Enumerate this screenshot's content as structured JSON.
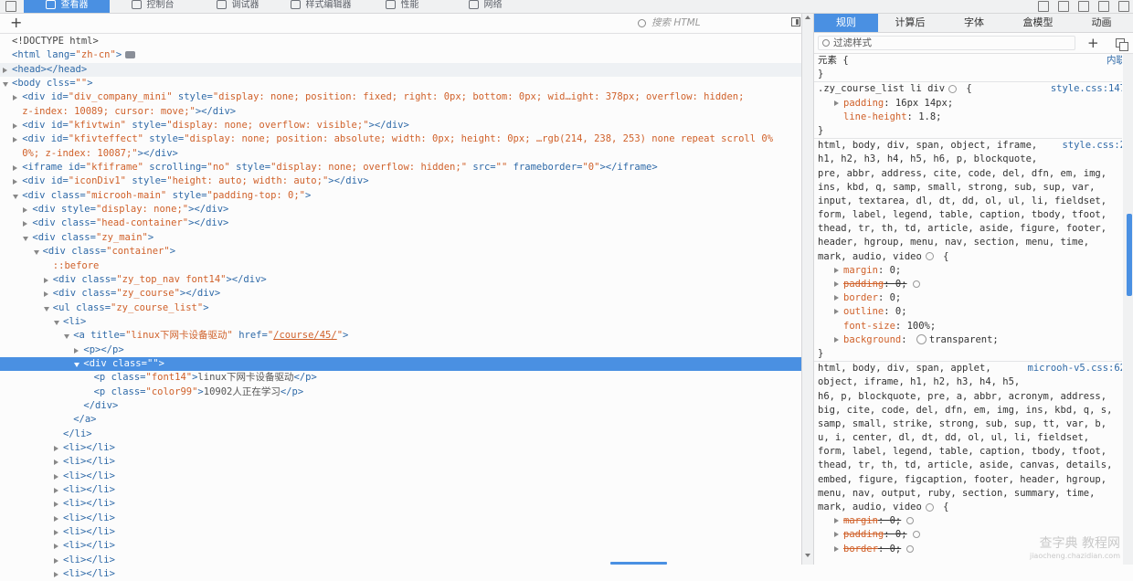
{
  "top_tabs": [
    "查看器",
    "控制台",
    "调试器",
    "样式编辑器",
    "性能",
    "网络"
  ],
  "markup": {
    "search_placeholder": "搜索 HTML",
    "add_label": "+",
    "lines": [
      [
        {
          "c": "p",
          "t": "<!DOCTYPE html>"
        }
      ],
      [
        {
          "c": "t",
          "t": "<html"
        },
        {
          "c": "a",
          "t": " lang="
        },
        {
          "c": "v",
          "t": "\"zh-cn\""
        },
        {
          "c": "t",
          "t": ">"
        }
      ],
      [
        {
          "c": "t",
          "t": "<head></head>"
        }
      ],
      [
        {
          "c": "t",
          "t": "<body"
        },
        {
          "c": "a",
          "t": " clss="
        },
        {
          "c": "v",
          "t": "\"\""
        },
        {
          "c": "t",
          "t": ">"
        }
      ],
      [
        {
          "c": "t",
          "t": "<div"
        },
        {
          "c": "a",
          "t": " id="
        },
        {
          "c": "v",
          "t": "\"div_company_mini\""
        },
        {
          "c": "a",
          "t": " style="
        },
        {
          "c": "v",
          "t": "\"display: none; position: fixed; right: 0px; bottom: 0px; wid…ight: 378px; overflow: hidden;"
        }
      ],
      [
        {
          "c": "v",
          "t": "z-index: 10089; cursor: move;\""
        },
        {
          "c": "t",
          "t": "></div>"
        }
      ],
      [
        {
          "c": "t",
          "t": "<div"
        },
        {
          "c": "a",
          "t": " id="
        },
        {
          "c": "v",
          "t": "\"kfivtwin\""
        },
        {
          "c": "a",
          "t": " style="
        },
        {
          "c": "v",
          "t": "\"display: none; overflow: visible;\""
        },
        {
          "c": "t",
          "t": "></div>"
        }
      ],
      [
        {
          "c": "t",
          "t": "<div"
        },
        {
          "c": "a",
          "t": " id="
        },
        {
          "c": "v",
          "t": "\"kfivteffect\""
        },
        {
          "c": "a",
          "t": " style="
        },
        {
          "c": "v",
          "t": "\"display: none; position: absolute; width: 0px; height: 0px; …rgb(214, 238, 253) none repeat scroll 0%"
        }
      ],
      [
        {
          "c": "v",
          "t": "0%; z-index: 10087;\""
        },
        {
          "c": "t",
          "t": "></div>"
        }
      ],
      [
        {
          "c": "t",
          "t": "<iframe"
        },
        {
          "c": "a",
          "t": " id="
        },
        {
          "c": "v",
          "t": "\"kfiframe\""
        },
        {
          "c": "a",
          "t": " scrolling="
        },
        {
          "c": "v",
          "t": "\"no\""
        },
        {
          "c": "a",
          "t": " style="
        },
        {
          "c": "v",
          "t": "\"display: none; overflow: hidden;\""
        },
        {
          "c": "a",
          "t": " src="
        },
        {
          "c": "v",
          "t": "\"\""
        },
        {
          "c": "a",
          "t": " frameborder="
        },
        {
          "c": "v",
          "t": "\"0\""
        },
        {
          "c": "t",
          "t": "></iframe>"
        }
      ],
      [
        {
          "c": "t",
          "t": "<div"
        },
        {
          "c": "a",
          "t": " id="
        },
        {
          "c": "v",
          "t": "\"iconDiv1\""
        },
        {
          "c": "a",
          "t": " style="
        },
        {
          "c": "v",
          "t": "\"height: auto; width: auto;\""
        },
        {
          "c": "t",
          "t": "></div>"
        }
      ],
      [
        {
          "c": "t",
          "t": "<div"
        },
        {
          "c": "a",
          "t": " class="
        },
        {
          "c": "v",
          "t": "\"microoh-main\""
        },
        {
          "c": "a",
          "t": " style="
        },
        {
          "c": "v",
          "t": "\"padding-top: 0;\""
        },
        {
          "c": "t",
          "t": ">"
        }
      ],
      [
        {
          "c": "t",
          "t": "<div"
        },
        {
          "c": "a",
          "t": " style="
        },
        {
          "c": "v",
          "t": "\"display: none;\""
        },
        {
          "c": "t",
          "t": "></div>"
        }
      ],
      [
        {
          "c": "t",
          "t": "<div"
        },
        {
          "c": "a",
          "t": " class="
        },
        {
          "c": "v",
          "t": "\"head-container\""
        },
        {
          "c": "t",
          "t": "></div>"
        }
      ],
      [
        {
          "c": "t",
          "t": "<div"
        },
        {
          "c": "a",
          "t": " class="
        },
        {
          "c": "v",
          "t": "\"zy_main\""
        },
        {
          "c": "t",
          "t": ">"
        }
      ],
      [
        {
          "c": "t",
          "t": "<div"
        },
        {
          "c": "a",
          "t": " class="
        },
        {
          "c": "v",
          "t": "\"container\""
        },
        {
          "c": "t",
          "t": ">"
        }
      ],
      [
        {
          "c": "ps",
          "t": "::before"
        }
      ],
      [
        {
          "c": "t",
          "t": "<div"
        },
        {
          "c": "a",
          "t": " class="
        },
        {
          "c": "v",
          "t": "\"zy_top_nav font14\""
        },
        {
          "c": "t",
          "t": "></div>"
        }
      ],
      [
        {
          "c": "t",
          "t": "<div"
        },
        {
          "c": "a",
          "t": " class="
        },
        {
          "c": "v",
          "t": "\"zy_course\""
        },
        {
          "c": "t",
          "t": "></div>"
        }
      ],
      [
        {
          "c": "t",
          "t": "<ul"
        },
        {
          "c": "a",
          "t": " class="
        },
        {
          "c": "v",
          "t": "\"zy_course_list\""
        },
        {
          "c": "t",
          "t": ">"
        }
      ],
      [
        {
          "c": "t",
          "t": "<li>"
        }
      ],
      [
        {
          "c": "t",
          "t": "<a"
        },
        {
          "c": "a",
          "t": " title="
        },
        {
          "c": "v",
          "t": "\"linux下网卡设备驱动\""
        },
        {
          "c": "a",
          "t": " href="
        },
        {
          "c": "v",
          "t": "\""
        },
        {
          "c": "lnk",
          "t": "/course/45/"
        },
        {
          "c": "v",
          "t": "\""
        },
        {
          "c": "t",
          "t": ">"
        }
      ],
      [
        {
          "c": "t",
          "t": "<p></p>"
        }
      ],
      [
        {
          "c": "t",
          "t": "<div"
        },
        {
          "c": "a",
          "t": " class="
        },
        {
          "c": "v",
          "t": "\"\""
        },
        {
          "c": "t",
          "t": ">"
        }
      ],
      [
        {
          "c": "t",
          "t": "<p"
        },
        {
          "c": "a",
          "t": " class="
        },
        {
          "c": "v",
          "t": "\"font14\""
        },
        {
          "c": "t",
          "t": ">"
        },
        {
          "c": "c",
          "t": "linux下网卡设备驱动"
        },
        {
          "c": "t",
          "t": "</p>"
        }
      ],
      [
        {
          "c": "t",
          "t": "<p"
        },
        {
          "c": "a",
          "t": " class="
        },
        {
          "c": "v",
          "t": "\"color99\""
        },
        {
          "c": "t",
          "t": ">"
        },
        {
          "c": "c",
          "t": "10902人正在学习"
        },
        {
          "c": "t",
          "t": "</p>"
        }
      ],
      [
        {
          "c": "t",
          "t": "</div>"
        }
      ],
      [
        {
          "c": "t",
          "t": "</a>"
        }
      ],
      [
        {
          "c": "t",
          "t": "</li>"
        }
      ],
      [
        {
          "c": "t",
          "t": "<li></li>"
        }
      ],
      [
        {
          "c": "t",
          "t": "<li></li>"
        }
      ],
      [
        {
          "c": "t",
          "t": "<li></li>"
        }
      ],
      [
        {
          "c": "t",
          "t": "<li></li>"
        }
      ],
      [
        {
          "c": "t",
          "t": "<li></li>"
        }
      ],
      [
        {
          "c": "t",
          "t": "<li></li>"
        }
      ],
      [
        {
          "c": "t",
          "t": "<li></li>"
        }
      ],
      [
        {
          "c": "t",
          "t": "<li></li>"
        }
      ],
      [
        {
          "c": "t",
          "t": "<li></li>"
        }
      ],
      [
        {
          "c": "t",
          "t": "<li></li>"
        }
      ]
    ],
    "meta": [
      {
        "d": 0,
        "tw": "none"
      },
      {
        "d": 0,
        "tw": "none",
        "ev": true
      },
      {
        "d": 0,
        "tw": "closed",
        "hover": true
      },
      {
        "d": 0,
        "tw": "open"
      },
      {
        "d": 1,
        "tw": "closed"
      },
      {
        "d": 1,
        "tw": "none"
      },
      {
        "d": 1,
        "tw": "closed"
      },
      {
        "d": 1,
        "tw": "closed"
      },
      {
        "d": 1,
        "tw": "none"
      },
      {
        "d": 1,
        "tw": "closed"
      },
      {
        "d": 1,
        "tw": "closed"
      },
      {
        "d": 1,
        "tw": "open"
      },
      {
        "d": 2,
        "tw": "closed"
      },
      {
        "d": 2,
        "tw": "closed"
      },
      {
        "d": 2,
        "tw": "open"
      },
      {
        "d": 3,
        "tw": "open"
      },
      {
        "d": 4,
        "tw": "none"
      },
      {
        "d": 4,
        "tw": "closed"
      },
      {
        "d": 4,
        "tw": "closed"
      },
      {
        "d": 4,
        "tw": "open"
      },
      {
        "d": 5,
        "tw": "open"
      },
      {
        "d": 6,
        "tw": "open"
      },
      {
        "d": 7,
        "tw": "closed"
      },
      {
        "d": 7,
        "tw": "open",
        "sel": true
      },
      {
        "d": 8,
        "tw": "none"
      },
      {
        "d": 8,
        "tw": "none"
      },
      {
        "d": 7,
        "tw": "none"
      },
      {
        "d": 6,
        "tw": "none"
      },
      {
        "d": 5,
        "tw": "none"
      },
      {
        "d": 5,
        "tw": "closed"
      },
      {
        "d": 5,
        "tw": "closed"
      },
      {
        "d": 5,
        "tw": "closed"
      },
      {
        "d": 5,
        "tw": "closed"
      },
      {
        "d": 5,
        "tw": "closed"
      },
      {
        "d": 5,
        "tw": "closed"
      },
      {
        "d": 5,
        "tw": "closed"
      },
      {
        "d": 5,
        "tw": "closed"
      },
      {
        "d": 5,
        "tw": "closed"
      },
      {
        "d": 5,
        "tw": "closed"
      }
    ]
  },
  "rules_panel": {
    "tabs": [
      "规则",
      "计算后",
      "字体",
      "盒模型",
      "动画"
    ],
    "filter_placeholder": "过滤样式",
    "element_label": "元素 {",
    "inline_label": "内联",
    "lines": [
      {
        "k": "plain",
        "t": "元素 {",
        "src": "内联"
      },
      {
        "k": "plain",
        "t": "}",
        "sep": true
      },
      {
        "k": "sel",
        "t": ".zy_course_list li div",
        "gear": true,
        "brace": true,
        "src": "style.css:147"
      },
      {
        "k": "prop",
        "p": "padding",
        "v": "16px 14px;",
        "tw": true
      },
      {
        "k": "prop",
        "p": "line-height",
        "v": "1.8;"
      },
      {
        "k": "plain",
        "t": "}",
        "sep": true
      },
      {
        "k": "list",
        "t": "html, body, div, span, object, iframe,",
        "src": "style.css:2"
      },
      {
        "k": "list",
        "t": "h1, h2, h3, h4, h5, h6, p, blockquote,"
      },
      {
        "k": "list",
        "t": "pre, abbr, address, cite, code, del, dfn, em, img,"
      },
      {
        "k": "list",
        "t": "ins, kbd, q, samp, small, strong, sub, sup, var,"
      },
      {
        "k": "list",
        "t": "input, textarea, dl, dt, dd, ol, ul, li, fieldset,"
      },
      {
        "k": "list",
        "t": "form, label, legend, table, caption, tbody, tfoot,"
      },
      {
        "k": "list",
        "t": "thead, tr, th, td, article, aside, figure, footer,"
      },
      {
        "k": "list",
        "t": "header, hgroup, menu, nav, section, menu, time,"
      },
      {
        "k": "list",
        "t": "mark, audio, video",
        "gear": true,
        "brace": true
      },
      {
        "k": "prop",
        "p": "margin",
        "v": "0;",
        "tw": true
      },
      {
        "k": "prop",
        "p": "padding",
        "v": "0;",
        "tw": true,
        "strike": true,
        "lens": true
      },
      {
        "k": "prop",
        "p": "border",
        "v": "0;",
        "tw": true
      },
      {
        "k": "prop",
        "p": "outline",
        "v": "0;",
        "tw": true
      },
      {
        "k": "prop",
        "p": "font-size",
        "v": "100%;"
      },
      {
        "k": "prop",
        "p": "background",
        "v": "transparent;",
        "tw": true,
        "swatch": true
      },
      {
        "k": "plain",
        "t": "}",
        "sep": true
      },
      {
        "k": "list",
        "t": "html, body, div, span, applet,",
        "src": "microoh-v5.css:62"
      },
      {
        "k": "list",
        "t": "object, iframe, h1, h2, h3, h4, h5,"
      },
      {
        "k": "list",
        "t": "h6, p, blockquote, pre, a, abbr, acronym, address,"
      },
      {
        "k": "list",
        "t": "big, cite, code, del, dfn, em, img, ins, kbd, q, s,"
      },
      {
        "k": "list",
        "t": "samp, small, strike, strong, sub, sup, tt, var, b,"
      },
      {
        "k": "list",
        "t": "u, i, center, dl, dt, dd, ol, ul, li, fieldset,"
      },
      {
        "k": "list",
        "t": "form, label, legend, table, caption, tbody, tfoot,"
      },
      {
        "k": "list",
        "t": "thead, tr, th, td, article, aside, canvas, details,"
      },
      {
        "k": "list",
        "t": "embed, figure, figcaption, footer, header, hgroup,"
      },
      {
        "k": "list",
        "t": "menu, nav, output, ruby, section, summary, time,"
      },
      {
        "k": "list",
        "t": "mark, audio, video",
        "gear": true,
        "brace": true
      },
      {
        "k": "prop",
        "p": "margin",
        "v": "0;",
        "tw": true,
        "strike": true,
        "lens": true
      },
      {
        "k": "prop",
        "p": "padding",
        "v": "0;",
        "tw": true,
        "strike": true,
        "lens": true
      },
      {
        "k": "prop",
        "p": "border",
        "v": "0;",
        "tw": true,
        "strike": true,
        "lens": true
      }
    ]
  },
  "watermark": {
    "main": "查字典 教程网",
    "sub": "jiaocheng.chazidian.com"
  }
}
